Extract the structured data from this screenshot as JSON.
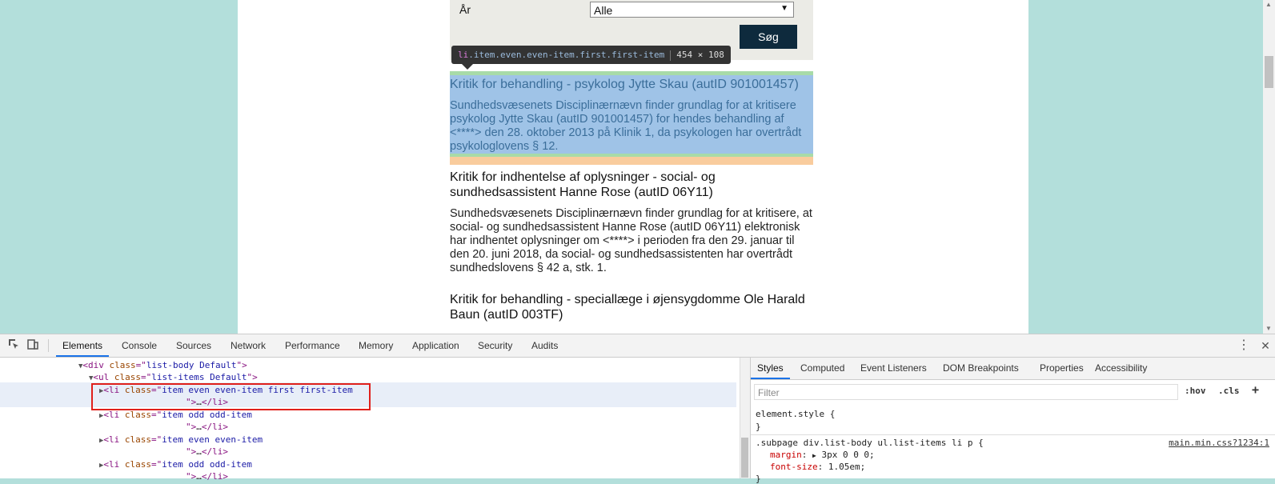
{
  "page": {
    "filter": {
      "year_label": "År",
      "year_value": "Alle",
      "search_button": "Søg"
    },
    "tooltip": {
      "tag": "li",
      "classes": ".item.even.even-item.first.first-item",
      "dims": "454 × 108"
    },
    "items": [
      {
        "title": "Kritik for behandling - psykolog Jytte Skau (autID 901001457)",
        "body": "Sundhedsvæsenets Disciplinærnævn finder grundlag for at kritisere psykolog Jytte Skau (autID 901001457) for hendes behandling af <****> den 28. oktober 2013 på Klinik 1, da psykologen har overtrådt psykologlovens § 12."
      },
      {
        "title": "Kritik for indhentelse af oplysninger - social- og sundhedsassistent Hanne Rose (autID 06Y11)",
        "body": "Sundhedsvæsenets Disciplinærnævn finder grundlag for at kritisere, at social- og sundhedsassistent Hanne Rose (autID 06Y11) elektronisk har indhentet oplysninger om <****> i perioden fra den 29. januar til den 20. juni 2018, da social- og sundhedsassistenten har overtrådt sundhedslovens § 42 a, stk. 1."
      },
      {
        "title": "Kritik for behandling - speciallæge i øjensygdomme Ole Harald Baun (autID 003TF)",
        "body": ""
      }
    ]
  },
  "devtools": {
    "tabs": [
      "Elements",
      "Console",
      "Sources",
      "Network",
      "Performance",
      "Memory",
      "Application",
      "Security",
      "Audits"
    ],
    "active_tab": "Elements",
    "dom": {
      "div_tag": "div",
      "div_attr": "class",
      "div_class": "list-body Default",
      "ul_tag": "ul",
      "ul_attr": "class",
      "ul_class": "list-items Default",
      "li_items": [
        {
          "class_value": "item even even-item first first-item"
        },
        {
          "class_value": "item odd odd-item"
        },
        {
          "class_value": "item even even-item"
        },
        {
          "class_value": "item odd odd-item"
        }
      ],
      "li_tag": "li",
      "li_attr": "class",
      "collapsed": "…",
      "close_li": "</li>"
    },
    "styles_tabs": [
      "Styles",
      "Computed",
      "Event Listeners",
      "DOM Breakpoints",
      "Properties",
      "Accessibility"
    ],
    "styles": {
      "filter_placeholder": "Filter",
      "hov": ":hov",
      "cls": ".cls",
      "plus": "+",
      "element_style": "element.style {",
      "close_brace": "}",
      "rule_selector": ".subpage div.list-body ul.list-items li p {",
      "rule_source": "main.min.css?1234:1",
      "prop1_name": "margin",
      "prop1_value": "3px 0 0 0;",
      "prop2_name": "font-size",
      "prop2_value": "1.05em;"
    }
  }
}
